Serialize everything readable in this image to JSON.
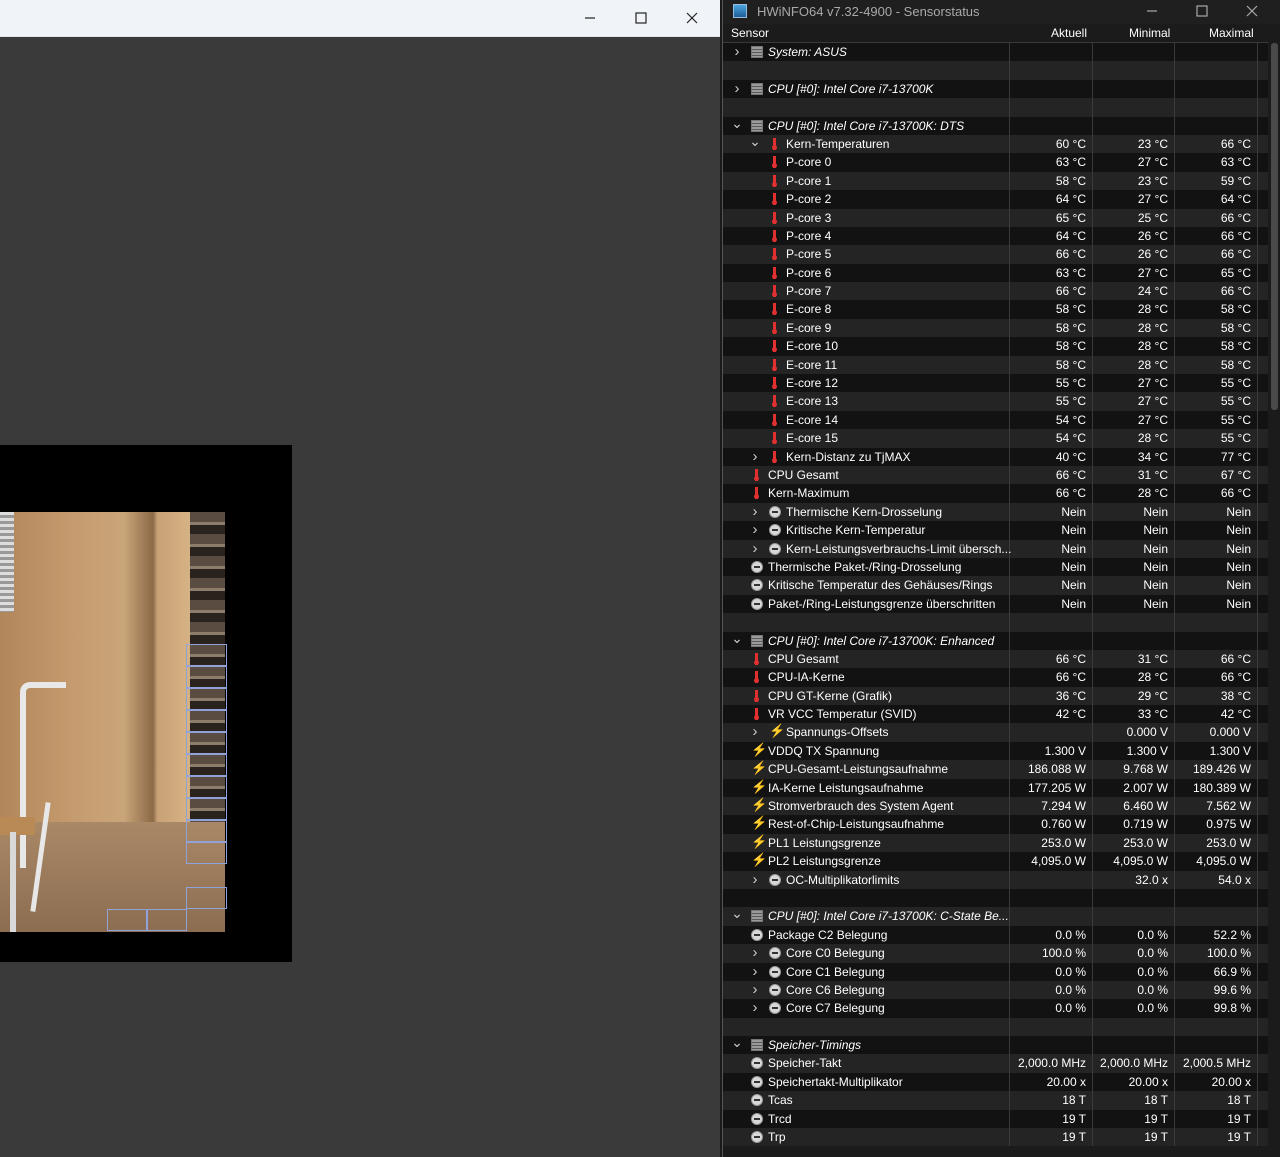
{
  "left_window": {
    "minimize_glyph": "—",
    "close_glyph": "✕"
  },
  "hwinfo": {
    "title": "HWiNFO64 v7.32-4900 - Sensorstatus",
    "columns": [
      "Sensor",
      "Aktuell",
      "Minimal",
      "Maximal"
    ],
    "rows": [
      {
        "level": 0,
        "expander": "closed",
        "icon": "chip",
        "section": true,
        "label": "System: ASUS",
        "v": [
          "",
          "",
          ""
        ]
      },
      {
        "blank": true
      },
      {
        "level": 0,
        "expander": "closed",
        "icon": "chip",
        "section": true,
        "label": "CPU [#0]: Intel Core i7-13700K",
        "v": [
          "",
          "",
          ""
        ]
      },
      {
        "blank": true
      },
      {
        "level": 0,
        "expander": "open",
        "icon": "chip",
        "section": true,
        "label": "CPU [#0]: Intel Core i7-13700K: DTS",
        "v": [
          "",
          "",
          ""
        ]
      },
      {
        "level": 1,
        "expander": "open",
        "icon": "therm",
        "label": "Kern-Temperaturen",
        "v": [
          "60 °C",
          "23 °C",
          "66 °C"
        ]
      },
      {
        "level": 2,
        "icon": "therm",
        "label": "P-core 0",
        "v": [
          "63 °C",
          "27 °C",
          "63 °C"
        ]
      },
      {
        "level": 2,
        "icon": "therm",
        "label": "P-core 1",
        "v": [
          "58 °C",
          "23 °C",
          "59 °C"
        ]
      },
      {
        "level": 2,
        "icon": "therm",
        "label": "P-core 2",
        "v": [
          "64 °C",
          "27 °C",
          "64 °C"
        ]
      },
      {
        "level": 2,
        "icon": "therm",
        "label": "P-core 3",
        "v": [
          "65 °C",
          "25 °C",
          "66 °C"
        ]
      },
      {
        "level": 2,
        "icon": "therm",
        "label": "P-core 4",
        "v": [
          "64 °C",
          "26 °C",
          "66 °C"
        ]
      },
      {
        "level": 2,
        "icon": "therm",
        "label": "P-core 5",
        "v": [
          "66 °C",
          "26 °C",
          "66 °C"
        ]
      },
      {
        "level": 2,
        "icon": "therm",
        "label": "P-core 6",
        "v": [
          "63 °C",
          "27 °C",
          "65 °C"
        ]
      },
      {
        "level": 2,
        "icon": "therm",
        "label": "P-core 7",
        "v": [
          "66 °C",
          "24 °C",
          "66 °C"
        ]
      },
      {
        "level": 2,
        "icon": "therm",
        "label": "E-core 8",
        "v": [
          "58 °C",
          "28 °C",
          "58 °C"
        ]
      },
      {
        "level": 2,
        "icon": "therm",
        "label": "E-core 9",
        "v": [
          "58 °C",
          "28 °C",
          "58 °C"
        ]
      },
      {
        "level": 2,
        "icon": "therm",
        "label": "E-core 10",
        "v": [
          "58 °C",
          "28 °C",
          "58 °C"
        ]
      },
      {
        "level": 2,
        "icon": "therm",
        "label": "E-core 11",
        "v": [
          "58 °C",
          "28 °C",
          "58 °C"
        ]
      },
      {
        "level": 2,
        "icon": "therm",
        "label": "E-core 12",
        "v": [
          "55 °C",
          "27 °C",
          "55 °C"
        ]
      },
      {
        "level": 2,
        "icon": "therm",
        "label": "E-core 13",
        "v": [
          "55 °C",
          "27 °C",
          "55 °C"
        ]
      },
      {
        "level": 2,
        "icon": "therm",
        "label": "E-core 14",
        "v": [
          "54 °C",
          "27 °C",
          "55 °C"
        ]
      },
      {
        "level": 2,
        "icon": "therm",
        "label": "E-core 15",
        "v": [
          "54 °C",
          "28 °C",
          "55 °C"
        ]
      },
      {
        "level": 1,
        "expander": "closed",
        "icon": "therm",
        "label": "Kern-Distanz zu TjMAX",
        "v": [
          "40 °C",
          "34 °C",
          "77 °C"
        ]
      },
      {
        "level": 1,
        "icon": "therm",
        "label": "CPU Gesamt",
        "v": [
          "66 °C",
          "31 °C",
          "67 °C"
        ],
        "noindent": true
      },
      {
        "level": 1,
        "icon": "therm",
        "label": "Kern-Maximum",
        "v": [
          "66 °C",
          "28 °C",
          "66 °C"
        ],
        "noindent": true
      },
      {
        "level": 1,
        "expander": "closed",
        "icon": "clock",
        "label": "Thermische Kern-Drosselung",
        "v": [
          "Nein",
          "Nein",
          "Nein"
        ]
      },
      {
        "level": 1,
        "expander": "closed",
        "icon": "clock",
        "label": "Kritische Kern-Temperatur",
        "v": [
          "Nein",
          "Nein",
          "Nein"
        ]
      },
      {
        "level": 1,
        "expander": "closed",
        "icon": "clock",
        "label": "Kern-Leistungsverbrauchs-Limit übersch...",
        "v": [
          "Nein",
          "Nein",
          "Nein"
        ]
      },
      {
        "level": 1,
        "icon": "clock",
        "label": "Thermische Paket-/Ring-Drosselung",
        "v": [
          "Nein",
          "Nein",
          "Nein"
        ],
        "noindent": true
      },
      {
        "level": 1,
        "icon": "clock",
        "label": "Kritische Temperatur des Gehäuses/Rings",
        "v": [
          "Nein",
          "Nein",
          "Nein"
        ],
        "noindent": true
      },
      {
        "level": 1,
        "icon": "clock",
        "label": "Paket-/Ring-Leistungsgrenze überschritten",
        "v": [
          "Nein",
          "Nein",
          "Nein"
        ],
        "noindent": true
      },
      {
        "blank": true
      },
      {
        "level": 0,
        "expander": "open",
        "icon": "chip",
        "section": true,
        "label": "CPU [#0]: Intel Core i7-13700K: Enhanced",
        "v": [
          "",
          "",
          ""
        ]
      },
      {
        "level": 1,
        "icon": "therm",
        "label": "CPU Gesamt",
        "v": [
          "66 °C",
          "31 °C",
          "66 °C"
        ],
        "noindent": true
      },
      {
        "level": 1,
        "icon": "therm",
        "label": "CPU-IA-Kerne",
        "v": [
          "66 °C",
          "28 °C",
          "66 °C"
        ],
        "noindent": true
      },
      {
        "level": 1,
        "icon": "therm",
        "label": "CPU GT-Kerne (Grafik)",
        "v": [
          "36 °C",
          "29 °C",
          "38 °C"
        ],
        "noindent": true
      },
      {
        "level": 1,
        "icon": "therm",
        "label": "VR VCC Temperatur (SVID)",
        "v": [
          "42 °C",
          "33 °C",
          "42 °C"
        ],
        "noindent": true
      },
      {
        "level": 1,
        "expander": "closed",
        "icon": "bolt",
        "label": "Spannungs-Offsets",
        "v": [
          "",
          "0.000 V",
          "0.000 V"
        ]
      },
      {
        "level": 1,
        "icon": "bolt",
        "label": "VDDQ TX Spannung",
        "v": [
          "1.300 V",
          "1.300 V",
          "1.300 V"
        ],
        "noindent": true
      },
      {
        "level": 1,
        "icon": "bolt",
        "label": "CPU-Gesamt-Leistungsaufnahme",
        "v": [
          "186.088 W",
          "9.768 W",
          "189.426 W"
        ],
        "noindent": true
      },
      {
        "level": 1,
        "icon": "bolt",
        "label": "IA-Kerne Leistungsaufnahme",
        "v": [
          "177.205 W",
          "2.007 W",
          "180.389 W"
        ],
        "noindent": true
      },
      {
        "level": 1,
        "icon": "bolt",
        "label": "Stromverbrauch des System Agent",
        "v": [
          "7.294 W",
          "6.460 W",
          "7.562 W"
        ],
        "noindent": true
      },
      {
        "level": 1,
        "icon": "bolt",
        "label": "Rest-of-Chip-Leistungsaufnahme",
        "v": [
          "0.760 W",
          "0.719 W",
          "0.975 W"
        ],
        "noindent": true
      },
      {
        "level": 1,
        "icon": "bolt",
        "label": "PL1 Leistungsgrenze",
        "v": [
          "253.0 W",
          "253.0 W",
          "253.0 W"
        ],
        "noindent": true
      },
      {
        "level": 1,
        "icon": "bolt",
        "label": "PL2 Leistungsgrenze",
        "v": [
          "4,095.0 W",
          "4,095.0 W",
          "4,095.0 W"
        ],
        "noindent": true
      },
      {
        "level": 1,
        "expander": "closed",
        "icon": "clock",
        "label": "OC-Multiplikatorlimits",
        "v": [
          "",
          "32.0 x",
          "54.0 x"
        ]
      },
      {
        "blank": true
      },
      {
        "level": 0,
        "expander": "open",
        "icon": "chip",
        "section": true,
        "label": "CPU [#0]: Intel Core i7-13700K: C-State Be...",
        "v": [
          "",
          "",
          ""
        ]
      },
      {
        "level": 1,
        "icon": "clock",
        "label": "Package C2 Belegung",
        "v": [
          "0.0 %",
          "0.0 %",
          "52.2 %"
        ],
        "noindent": true
      },
      {
        "level": 1,
        "expander": "closed",
        "icon": "clock",
        "label": "Core C0 Belegung",
        "v": [
          "100.0 %",
          "0.0 %",
          "100.0 %"
        ]
      },
      {
        "level": 1,
        "expander": "closed",
        "icon": "clock",
        "label": "Core C1 Belegung",
        "v": [
          "0.0 %",
          "0.0 %",
          "66.9 %"
        ]
      },
      {
        "level": 1,
        "expander": "closed",
        "icon": "clock",
        "label": "Core C6 Belegung",
        "v": [
          "0.0 %",
          "0.0 %",
          "99.6 %"
        ]
      },
      {
        "level": 1,
        "expander": "closed",
        "icon": "clock",
        "label": "Core C7 Belegung",
        "v": [
          "0.0 %",
          "0.0 %",
          "99.8 %"
        ]
      },
      {
        "blank": true
      },
      {
        "level": 0,
        "expander": "open",
        "icon": "chip",
        "section": true,
        "label": "Speicher-Timings",
        "v": [
          "",
          "",
          ""
        ]
      },
      {
        "level": 1,
        "icon": "clock",
        "label": "Speicher-Takt",
        "v": [
          "2,000.0 MHz",
          "2,000.0 MHz",
          "2,000.5 MHz"
        ],
        "noindent": true
      },
      {
        "level": 1,
        "icon": "clock",
        "label": "Speichertakt-Multiplikator",
        "v": [
          "20.00 x",
          "20.00 x",
          "20.00 x"
        ],
        "noindent": true
      },
      {
        "level": 1,
        "icon": "clock",
        "label": "Tcas",
        "v": [
          "18 T",
          "18 T",
          "18 T"
        ],
        "noindent": true
      },
      {
        "level": 1,
        "icon": "clock",
        "label": "Trcd",
        "v": [
          "19 T",
          "19 T",
          "19 T"
        ],
        "noindent": true
      },
      {
        "level": 1,
        "icon": "clock",
        "label": "Trp",
        "v": [
          "19 T",
          "19 T",
          "19 T"
        ],
        "noindent": true
      }
    ]
  }
}
